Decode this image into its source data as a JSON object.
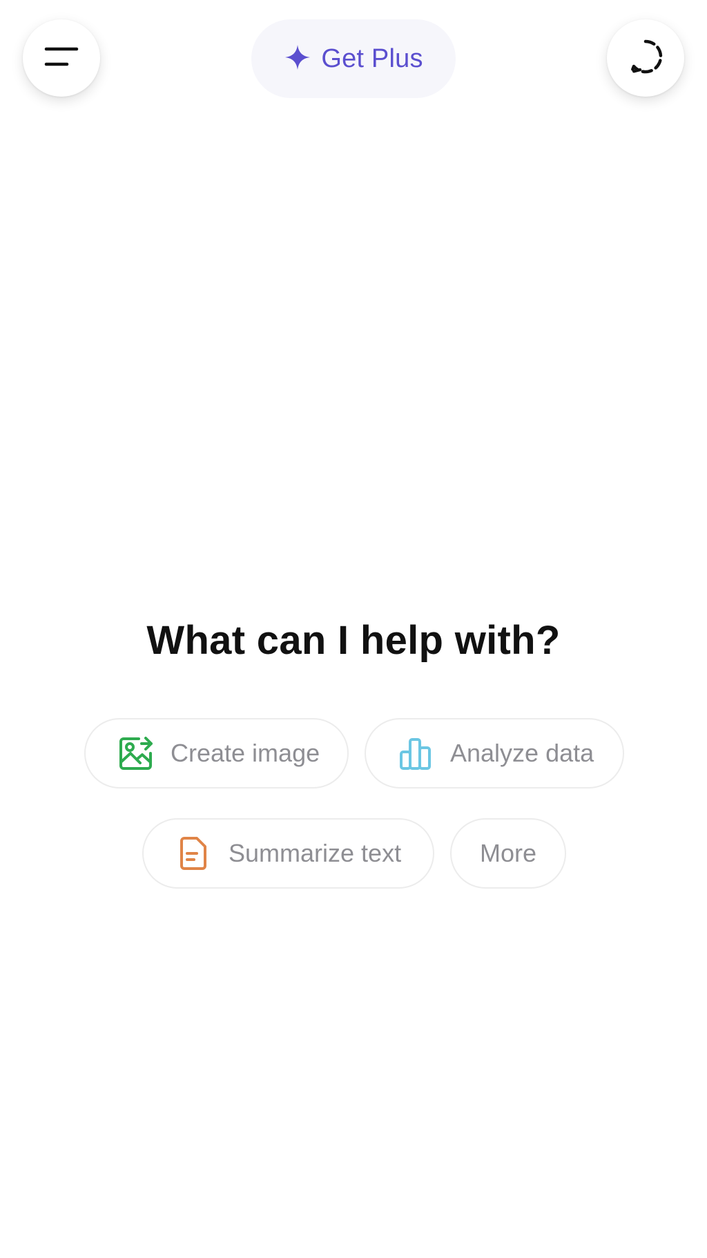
{
  "header": {
    "menu_icon": "menu-icon",
    "upgrade_label": "Get Plus",
    "upgrade_icon": "sparkle-icon",
    "new_chat_icon": "temporary-chat-icon",
    "accent_color": "#5b4fcf"
  },
  "main": {
    "heading": "What can I help with?"
  },
  "suggestions": [
    {
      "label": "Create image",
      "icon": "image-icon",
      "color": "#2eab4f"
    },
    {
      "label": "Analyze data",
      "icon": "bar-chart-icon",
      "color": "#6bc6e3"
    },
    {
      "label": "Summarize text",
      "icon": "document-icon",
      "color": "#e08447"
    },
    {
      "label": "More"
    }
  ]
}
